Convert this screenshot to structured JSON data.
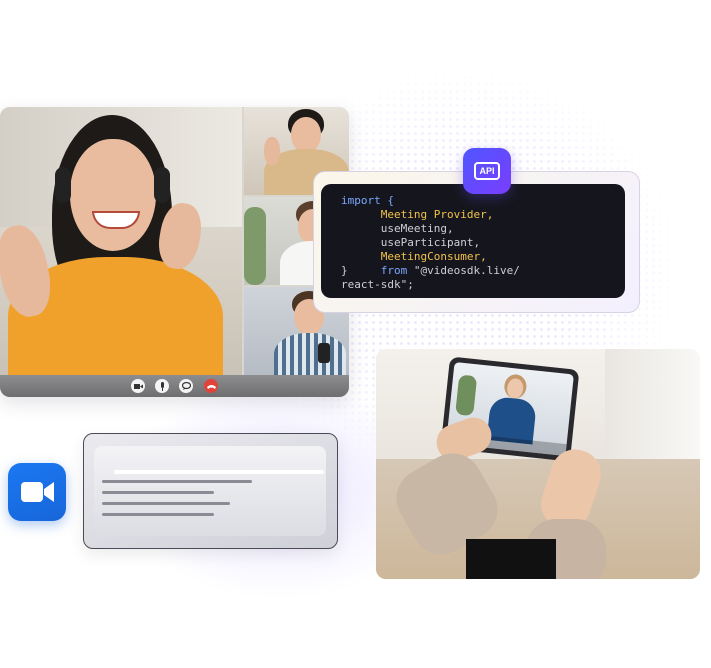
{
  "call": {
    "controls": {
      "camera_icon": "camera-icon",
      "mic_icon": "microphone-icon",
      "chat_icon": "chat-icon",
      "end_icon": "end-call-icon",
      "end_color": "#e0433a"
    }
  },
  "code": {
    "lines": [
      "import {",
      "Meeting Provider,",
      "useMeeting,",
      "useParticipant,",
      "MeetingConsumer,",
      "}",
      "from",
      "\"@videosdk.live/",
      "react-sdk\";"
    ]
  },
  "api_badge": {
    "label": "API",
    "colors": [
      "#4f56ff",
      "#7a3dff"
    ]
  },
  "zoom_logo": {
    "icon": "zoom-camera-icon",
    "color": "#1b78f2"
  }
}
